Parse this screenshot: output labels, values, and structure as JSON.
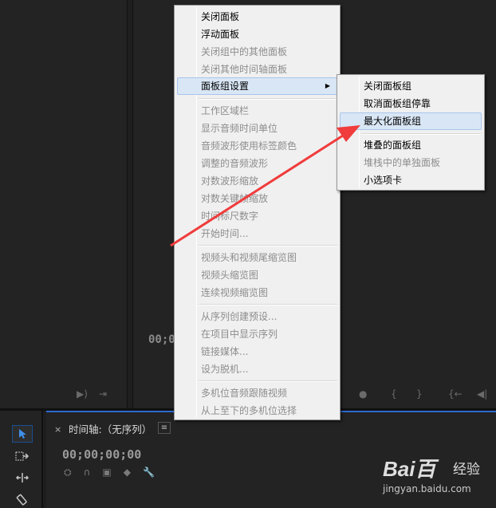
{
  "background": {
    "timecode": "00;0",
    "icons_left": [
      "▶)",
      "⇥"
    ],
    "icons_right": [
      "●",
      "{",
      "}",
      "{←",
      "◀|"
    ]
  },
  "timeline": {
    "close_label": "×",
    "title": "时间轴:（无序列）",
    "menu_icon": "≡",
    "timecode": "00;00;00;00",
    "icons": [
      "⛭",
      "∩",
      "▣",
      "◆",
      "🔧"
    ]
  },
  "tools": [
    "selection-tool",
    "track-select-tool",
    "ripple-edit-tool",
    "razor-tool"
  ],
  "context_menu": {
    "items": [
      {
        "label": "关闭面板",
        "enabled": true
      },
      {
        "label": "浮动面板",
        "enabled": true
      },
      {
        "label": "关闭组中的其他面板",
        "enabled": false
      },
      {
        "label": "关闭其他时间轴面板",
        "enabled": false
      },
      {
        "label": "面板组设置",
        "enabled": true,
        "submenu": true,
        "highlighted": true
      },
      {
        "separator": true
      },
      {
        "label": "工作区域栏",
        "enabled": false
      },
      {
        "label": "显示音频时间单位",
        "enabled": false
      },
      {
        "label": "音频波形使用标签颜色",
        "enabled": false
      },
      {
        "label": "调整的音频波形",
        "enabled": false
      },
      {
        "label": "对数波形缩放",
        "enabled": false
      },
      {
        "label": "对数关键帧缩放",
        "enabled": false
      },
      {
        "label": "时间标尺数字",
        "enabled": false
      },
      {
        "label": "开始时间...",
        "enabled": false
      },
      {
        "separator": true
      },
      {
        "label": "视频头和视频尾缩览图",
        "enabled": false
      },
      {
        "label": "视频头缩览图",
        "enabled": false
      },
      {
        "label": "连续视频缩览图",
        "enabled": false
      },
      {
        "separator": true
      },
      {
        "label": "从序列创建预设...",
        "enabled": false
      },
      {
        "label": "在项目中显示序列",
        "enabled": false
      },
      {
        "label": "链接媒体...",
        "enabled": false
      },
      {
        "label": "设为脱机...",
        "enabled": false
      },
      {
        "separator": true
      },
      {
        "label": "多机位音频跟随视频",
        "enabled": false
      },
      {
        "label": "从上至下的多机位选择",
        "enabled": false
      }
    ]
  },
  "submenu": {
    "items": [
      {
        "label": "关闭面板组",
        "enabled": true
      },
      {
        "label": "取消面板组停靠",
        "enabled": true
      },
      {
        "label": "最大化面板组",
        "enabled": true,
        "highlighted": true
      },
      {
        "separator": true
      },
      {
        "label": "堆叠的面板组",
        "enabled": true
      },
      {
        "label": "堆栈中的单独面板",
        "enabled": false
      },
      {
        "label": "小选项卡",
        "enabled": true
      }
    ]
  },
  "annotation": {
    "color": "#f03c3c"
  },
  "watermark": {
    "logo_text": "Bai",
    "logo_suffix": "百",
    "brand_cn": "经验",
    "url": "jingyan.baidu.com"
  }
}
